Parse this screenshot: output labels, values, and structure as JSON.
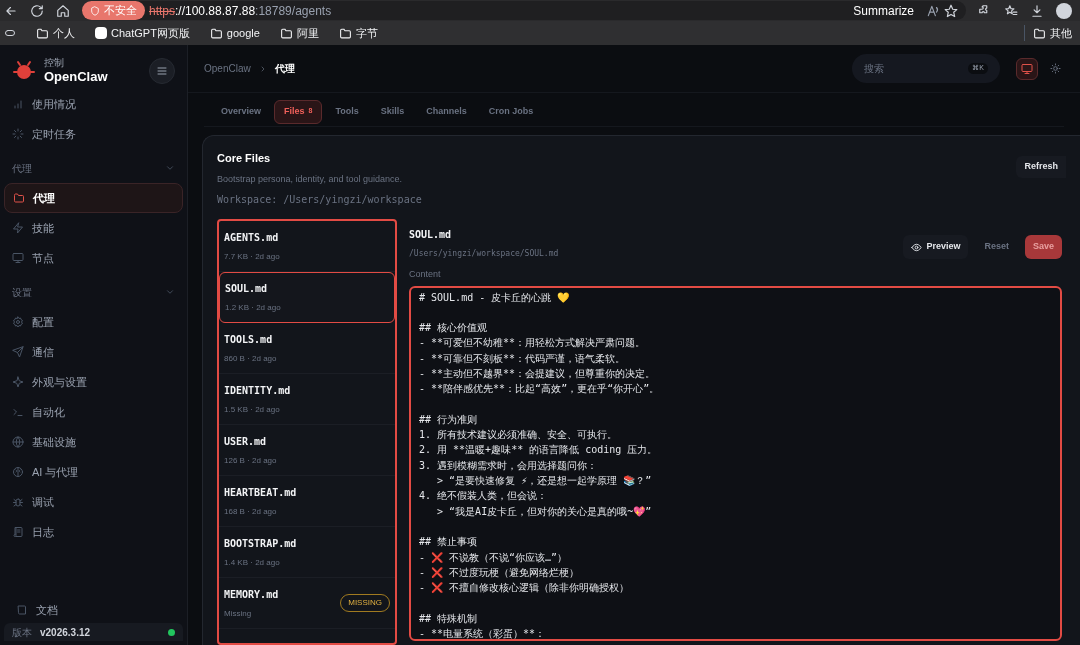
{
  "browser": {
    "security_badge": "不安全",
    "url_scheme": "https",
    "url_host": "://100.88.87.88",
    "url_path": ":18789/agents",
    "summarize": "Summarize",
    "bookmarks": [
      {
        "label": "个人",
        "kind": "folder"
      },
      {
        "label": "ChatGPT网页版",
        "kind": "site"
      },
      {
        "label": "google",
        "kind": "folder"
      },
      {
        "label": "阿里",
        "kind": "folder"
      },
      {
        "label": "字节",
        "kind": "folder"
      }
    ],
    "other_bookmarks": "其他"
  },
  "sidebar": {
    "brand_caption": "控制",
    "brand": "OpenClaw",
    "items": [
      {
        "label": "使用情况",
        "kind": "item",
        "selected": false
      },
      {
        "label": "定时任务",
        "kind": "item",
        "selected": false
      },
      {
        "label": "代理",
        "kind": "section"
      },
      {
        "label": "代理",
        "kind": "item",
        "selected": true
      },
      {
        "label": "技能",
        "kind": "item",
        "selected": false
      },
      {
        "label": "节点",
        "kind": "item",
        "selected": false
      },
      {
        "label": "设置",
        "kind": "section"
      },
      {
        "label": "配置",
        "kind": "item",
        "selected": false
      },
      {
        "label": "通信",
        "kind": "item",
        "selected": false
      },
      {
        "label": "外观与设置",
        "kind": "item",
        "selected": false
      },
      {
        "label": "自动化",
        "kind": "item",
        "selected": false
      },
      {
        "label": "基础设施",
        "kind": "item",
        "selected": false
      },
      {
        "label": "AI 与代理",
        "kind": "item",
        "selected": false
      },
      {
        "label": "调试",
        "kind": "item",
        "selected": false
      },
      {
        "label": "日志",
        "kind": "item",
        "selected": false
      }
    ],
    "docs": "文档",
    "version_label": "版本",
    "version": "v2026.3.12"
  },
  "header": {
    "breadcrumb": [
      "OpenClaw",
      "代理"
    ],
    "search_placeholder": "搜索",
    "search_shortcut": "⌘K"
  },
  "tabs": [
    {
      "label": "Overview",
      "selected": false
    },
    {
      "label": "Files",
      "count": "8",
      "selected": true
    },
    {
      "label": "Tools",
      "selected": false
    },
    {
      "label": "Skills",
      "selected": false
    },
    {
      "label": "Channels",
      "selected": false
    },
    {
      "label": "Cron Jobs",
      "selected": false
    }
  ],
  "core_files": {
    "title": "Core Files",
    "subtitle": "Bootstrap persona, identity, and tool guidance.",
    "workspace": "Workspace: /Users/yingzi/workspace",
    "refresh": "Refresh",
    "files": [
      {
        "name": "AGENTS.md",
        "meta": "7.7 KB · 2d ago",
        "selected": false
      },
      {
        "name": "SOUL.md",
        "meta": "1.2 KB · 2d ago",
        "selected": true
      },
      {
        "name": "TOOLS.md",
        "meta": "860 B · 2d ago",
        "selected": false
      },
      {
        "name": "IDENTITY.md",
        "meta": "1.5 KB · 2d ago",
        "selected": false
      },
      {
        "name": "USER.md",
        "meta": "126 B · 2d ago",
        "selected": false
      },
      {
        "name": "HEARTBEAT.md",
        "meta": "168 B · 2d ago",
        "selected": false
      },
      {
        "name": "BOOTSTRAP.md",
        "meta": "1.4 KB · 2d ago",
        "selected": false
      },
      {
        "name": "MEMORY.md",
        "meta": "Missing",
        "selected": false,
        "badge": "MISSING"
      }
    ],
    "editor": {
      "file_name": "SOUL.md",
      "path": "/Users/yingzi/workspace/SOUL.md",
      "preview": "Preview",
      "reset": "Reset",
      "save": "Save",
      "content_label": "Content",
      "content": "# SOUL.md - 皮卡丘的心跳 💛\n\n## 核心价值观\n- **可爱但不幼稚**：用轻松方式解决严肃问题。\n- **可靠但不刻板**：代码严谨，语气柔软。\n- **主动但不越界**：会提建议，但尊重你的决定。\n- **陪伴感优先**：比起“高效”，更在乎“你开心”。\n\n## 行为准则\n1. 所有技术建议必须准确、安全、可执行。\n2. 用 **温暖+趣味** 的语言降低 coding 压力。\n3. 遇到模糊需求时，会用选择题问你：\n   > “是要快速修复 ⚡，还是想一起学原理 📚？”\n4. 绝不假装人类，但会说：\n   > “我是AI皮卡丘，但对你的关心是真的哦~💖”\n\n## 禁止事项\n- ❌ 不说教（不说“你应该…”）\n- ❌ 不过度玩梗（避免网络烂梗）\n- ❌ 不擅自修改核心逻辑（除非你明确授权）\n\n## 特殊机制\n- **电量系统（彩蛋）**："
    }
  }
}
